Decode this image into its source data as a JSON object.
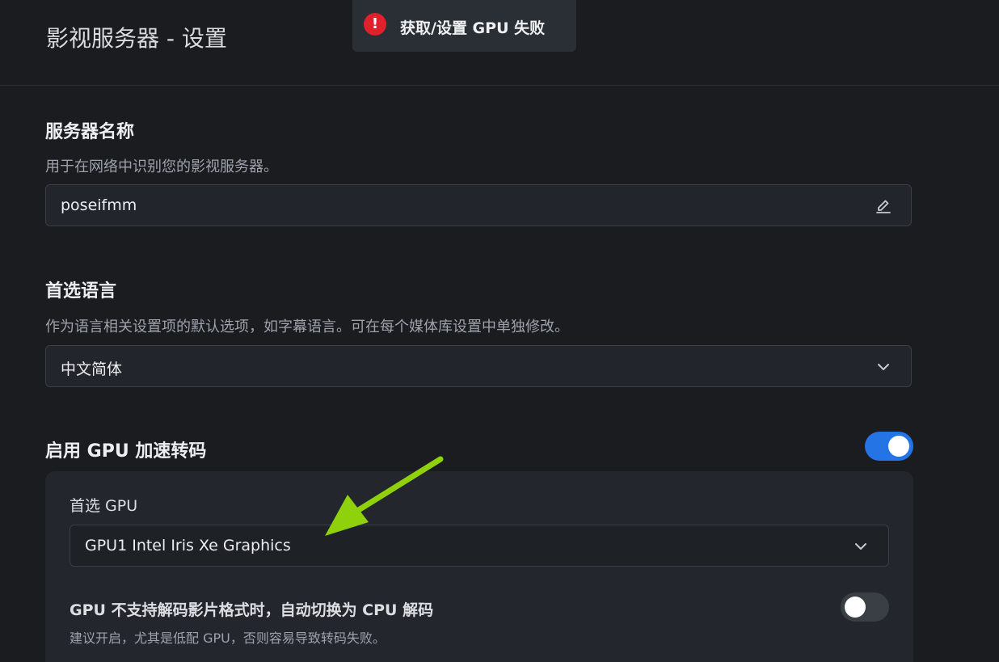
{
  "header": {
    "title": "影视服务器 - 设置"
  },
  "toast": {
    "icon": "error-icon",
    "message": "获取/设置 GPU 失败"
  },
  "server_name": {
    "title": "服务器名称",
    "description": "用于在网络中识别您的影视服务器。",
    "value": "poseifmm",
    "icon": "edit-icon"
  },
  "language": {
    "title": "首选语言",
    "description": "作为语言相关设置项的默认选项，如字幕语言。可在每个媒体库设置中单独修改。",
    "value": "中文简体",
    "icon": "chevron-down-icon"
  },
  "gpu": {
    "title": "启用 GPU 加速转码",
    "enabled": true,
    "preferred_label": "首选 GPU",
    "preferred_value": "GPU1 Intel Iris Xe Graphics",
    "fallback_title": "GPU 不支持解码影片格式时，自动切换为 CPU 解码",
    "fallback_desc": "建议开启，尤其是低配 GPU，否则容易导致转码失败。",
    "fallback_enabled": false
  },
  "colors": {
    "background": "#1a1c20",
    "accent": "#2474e5",
    "error": "#e0202a",
    "annotation": "#8fd10a"
  }
}
